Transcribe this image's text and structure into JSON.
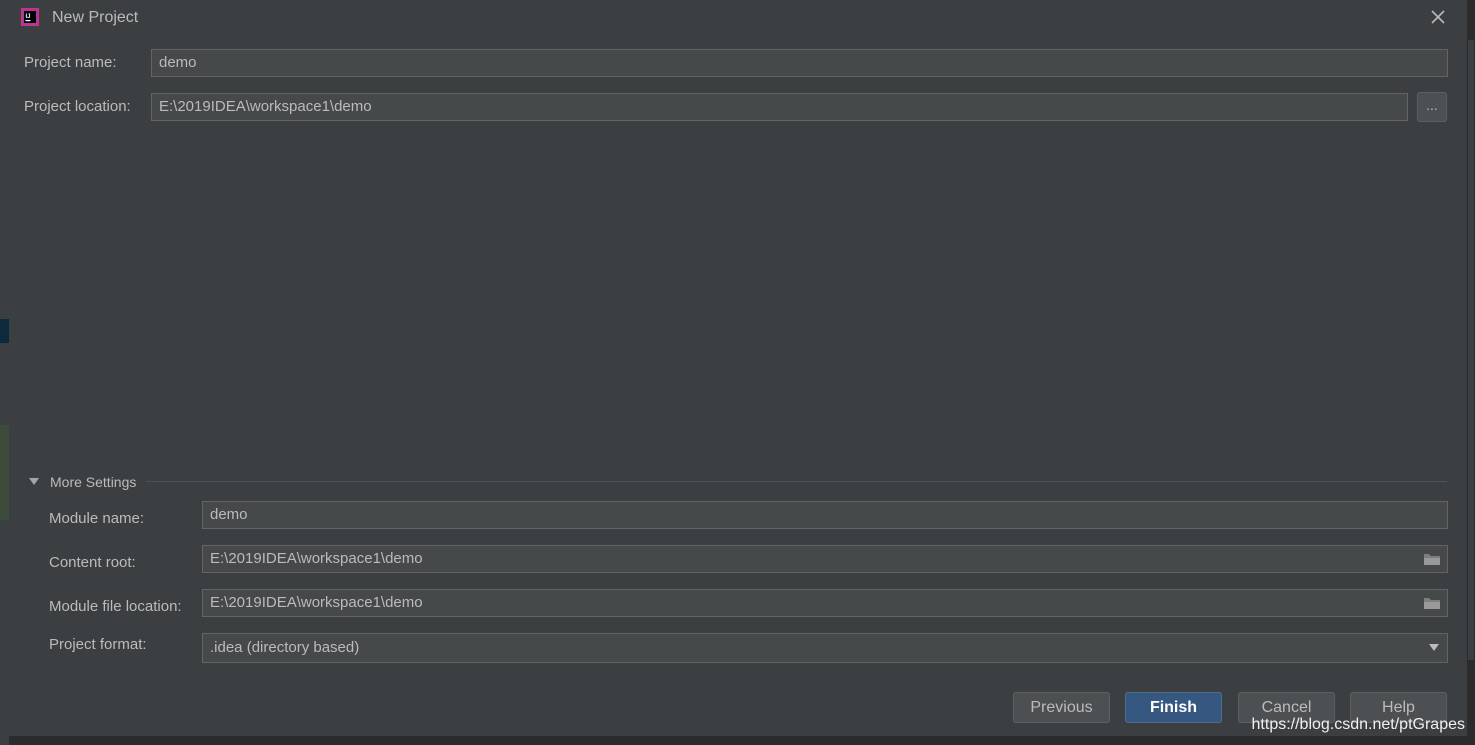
{
  "window": {
    "title": "New Project"
  },
  "project": {
    "name_label": "Project name:",
    "name_value": "demo",
    "location_label": "Project location:",
    "location_value": "E:\\2019IDEA\\workspace1\\demo",
    "browse_label": "..."
  },
  "more_settings": {
    "label": "More Settings",
    "module_name_label": "Module name:",
    "module_name_value": "demo",
    "content_root_label": "Content root:",
    "content_root_value": "E:\\2019IDEA\\workspace1\\demo",
    "module_file_label": "Module file location:",
    "module_file_value": "E:\\2019IDEA\\workspace1\\demo",
    "format_label": "Project format:",
    "format_value": ".idea (directory based)"
  },
  "buttons": {
    "previous": "Previous",
    "finish": "Finish",
    "cancel": "Cancel",
    "help": "Help"
  },
  "watermark": "https://blog.csdn.net/ptGrapes",
  "colors": {
    "accent": "#365880",
    "background": "#3c3f41",
    "field": "#45494a"
  }
}
